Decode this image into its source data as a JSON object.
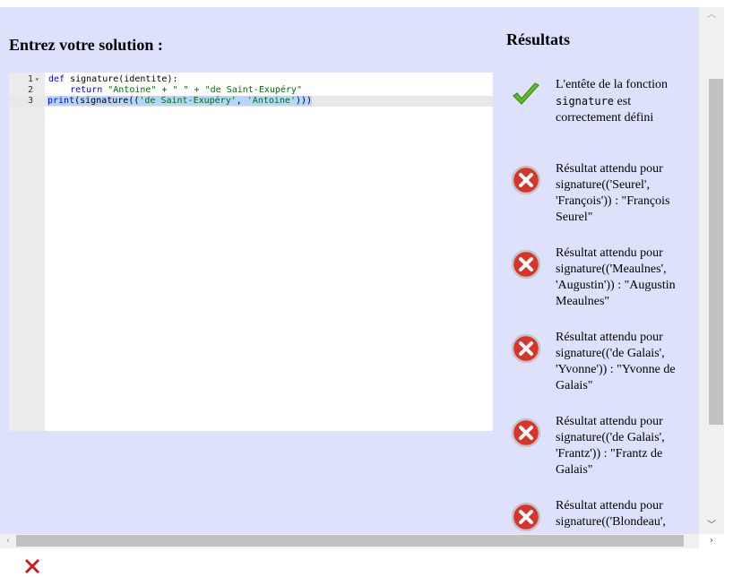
{
  "editor": {
    "title": "Entrez votre solution :",
    "lines": [
      {
        "num": "1",
        "pre": "def",
        "mid": " signature(identite):"
      },
      {
        "num": "2",
        "indent": "    ",
        "kw": "return",
        "s1": " \"Antoine\" + \" \" + \"de Saint-Exupéry\""
      },
      {
        "num": "3",
        "print": "print",
        "args": "(signature((",
        "s1": "'de Saint-Exupéry'",
        "comma": ", ",
        "s2": "'Antoine'",
        "close": ")))"
      }
    ]
  },
  "results": {
    "title": "Résultats",
    "items": [
      {
        "status": "pass",
        "text_before": "L'entête de la fonction ",
        "code": "signature",
        "text_after": " est correctement défini"
      },
      {
        "status": "fail",
        "text": "Résultat attendu pour signature(('Seurel', 'François')) : \"François Seurel\""
      },
      {
        "status": "fail",
        "text": "Résultat attendu pour signature(('Meaulnes', 'Augustin')) : \"Augustin Meaulnes\""
      },
      {
        "status": "fail",
        "text": "Résultat attendu pour signature(('de Galais', 'Yvonne')) : \"Yvonne de Galais\""
      },
      {
        "status": "fail",
        "text": "Résultat attendu pour signature(('de Galais', 'Frantz')) : \"Frantz de Galais\""
      },
      {
        "status": "fail",
        "text": "Résultat attendu pour signature(('Blondeau',"
      }
    ]
  },
  "icons": {
    "pass": "check-icon",
    "fail": "error-icon",
    "overall": "close-x-icon"
  },
  "colors": {
    "panel_bg": "#dde1fb",
    "check_green": "#5fbf2b",
    "error_red": "#d9342b",
    "overall_red": "#cc1a1a"
  }
}
